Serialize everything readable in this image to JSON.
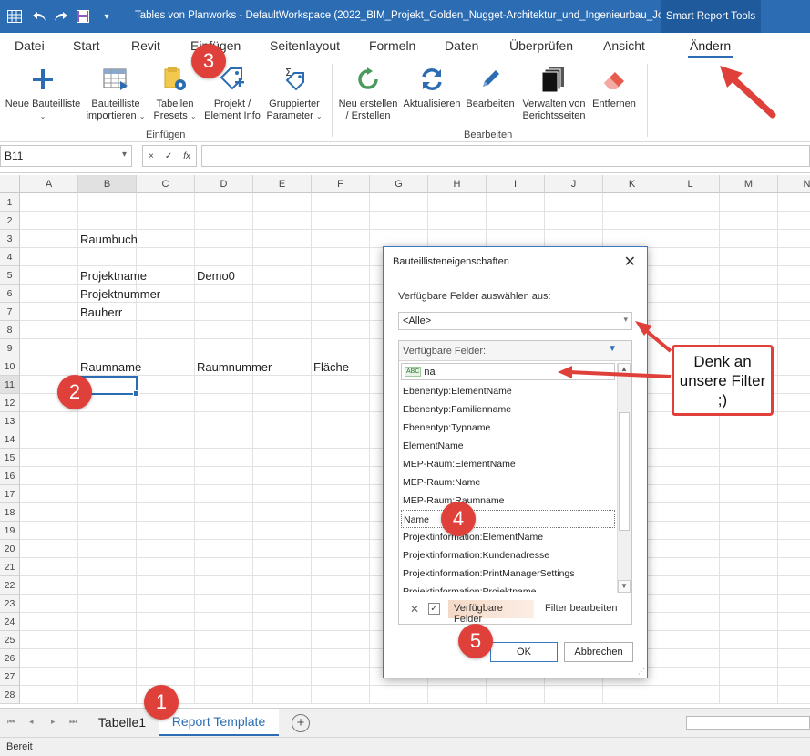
{
  "titlebar": {
    "doc_title": "Tables von Planworks - DefaultWorkspace  (2022_BIM_Projekt_Golden_Nugget-Architektur_und_Ingenieurbau_Jo)",
    "context_tab": "Smart Report Tools"
  },
  "menu": {
    "tabs": [
      "Datei",
      "Start",
      "Revit",
      "Einfügen",
      "Seitenlayout",
      "Formeln",
      "Daten",
      "Überprüfen",
      "Ansicht",
      "Ändern"
    ],
    "active": "Ändern"
  },
  "ribbon": {
    "group_einfuegen": {
      "label": "Einfügen",
      "buttons": [
        {
          "line1": "Neue Bauteilliste",
          "line2": ""
        },
        {
          "line1": "Bauteilliste",
          "line2": "importieren"
        },
        {
          "line1": "Tabellen",
          "line2": "Presets"
        },
        {
          "line1": "Projekt /",
          "line2": "Element Info"
        },
        {
          "line1": "Gruppierter",
          "line2": "Parameter"
        }
      ]
    },
    "group_bearbeiten": {
      "label": "Bearbeiten",
      "buttons": [
        {
          "line1": "Neu erstellen",
          "line2": "/ Erstellen"
        },
        {
          "line1": "Aktualisieren",
          "line2": ""
        },
        {
          "line1": "Bearbeiten",
          "line2": ""
        },
        {
          "line1": "Verwalten von",
          "line2": "Berichtsseiten"
        },
        {
          "line1": "Entfernen",
          "line2": ""
        }
      ]
    }
  },
  "formula_bar": {
    "name_box": "B11",
    "cancel": "×",
    "enter": "✓",
    "fx": "fx",
    "value": ""
  },
  "sheet": {
    "columns": [
      "A",
      "B",
      "C",
      "D",
      "E",
      "F",
      "G",
      "H",
      "I",
      "J",
      "K",
      "L",
      "M",
      "N"
    ],
    "rows": [
      "1",
      "2",
      "3",
      "4",
      "5",
      "6",
      "7",
      "8",
      "9",
      "10",
      "11",
      "12",
      "13",
      "14",
      "15",
      "16",
      "17",
      "18",
      "19",
      "20",
      "21",
      "22",
      "23",
      "24",
      "25",
      "26",
      "27",
      "28"
    ],
    "cells": {
      "b3": "Raumbuch",
      "b5": "Projektname",
      "d5": "Demo0",
      "b6": "Projektnummer",
      "b7": "Bauherr",
      "b10": "Raumname",
      "d10": "Raumnummer",
      "f10": "Fläche"
    }
  },
  "sheet_tabs": {
    "tab1": "Tabelle1",
    "tab2": "Report Template",
    "add": "+"
  },
  "status": {
    "text": "Bereit"
  },
  "dialog": {
    "title": "Bauteillisteneigenschaften",
    "close": "✕",
    "select_label": "Verfügbare Felder auswählen aus:",
    "select_value": "<Alle>",
    "panel_header": "Verfügbare Felder:",
    "search_value": "na",
    "fields": [
      "Ebenentyp:ElementName",
      "Ebenentyp:Familienname",
      "Ebenentyp:Typname",
      "ElementName",
      "MEP-Raum:ElementName",
      "MEP-Raum:Name",
      "MEP-Raum:Raumname",
      "Name",
      "Projektinformation:ElementName",
      "Projektinformation:Kundenadresse",
      "Projektinformation:PrintManagerSettings",
      "Projektinformation:Projektname"
    ],
    "selected_field": "Name",
    "footer_chip": "Verfügbare Felder",
    "footer_edit": "Filter bearbeiten",
    "ok": "OK",
    "cancel": "Abbrechen"
  },
  "annotations": {
    "badges": [
      "1",
      "2",
      "3",
      "4",
      "5"
    ],
    "callout": "Denk an unsere Filter ;)",
    "color": "#e0403a"
  },
  "colors": {
    "accent": "#2b6cb3",
    "annotation": "#e0403a"
  }
}
